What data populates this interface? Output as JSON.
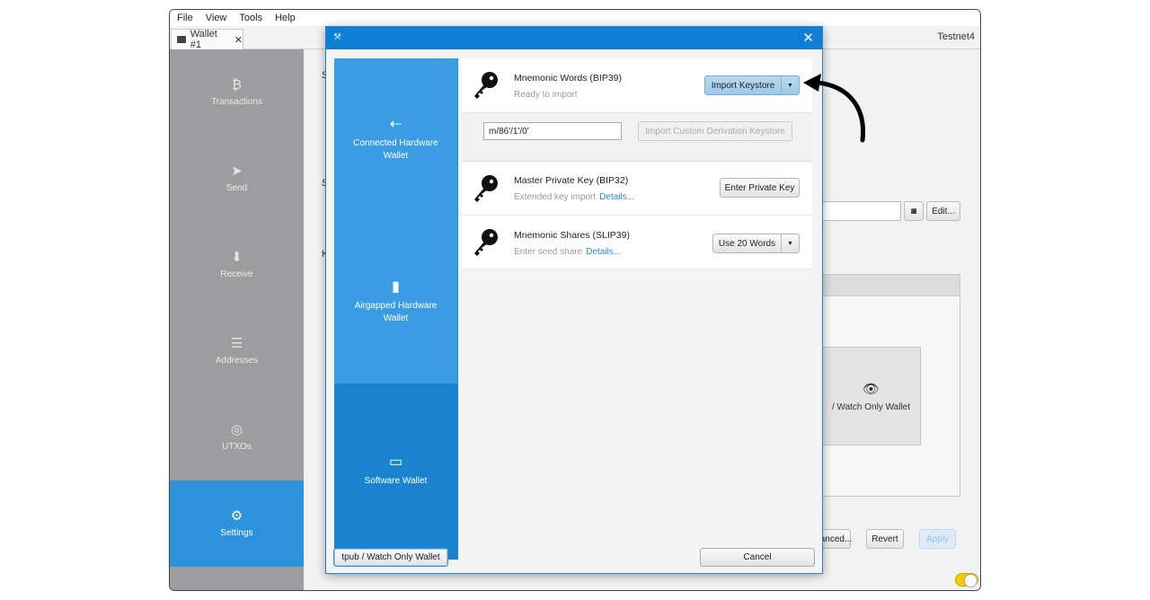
{
  "menu": [
    "File",
    "View",
    "Tools",
    "Help"
  ],
  "tab": {
    "label": "Wallet #1",
    "close": "✕"
  },
  "network": "Testnet4",
  "sidebar": {
    "items": [
      {
        "label": "Transactions",
        "icon": "bitcoin-icon",
        "glyph": "₿"
      },
      {
        "label": "Send",
        "icon": "send-icon",
        "glyph": "➤"
      },
      {
        "label": "Receive",
        "icon": "receive-icon",
        "glyph": "⬇"
      },
      {
        "label": "Addresses",
        "icon": "addresses-icon",
        "glyph": "☰"
      },
      {
        "label": "UTXOs",
        "icon": "coins-icon",
        "glyph": "◎"
      },
      {
        "label": "Settings",
        "icon": "gear-icon",
        "glyph": "⚙"
      }
    ]
  },
  "background": {
    "frag_s1": "S",
    "frag_s2": "S",
    "frag_k": "K",
    "edit_label": "Edit...",
    "watch_only_label": "/ Watch Only Wallet",
    "advanced_label": "anced...",
    "revert_label": "Revert",
    "apply_label": "Apply"
  },
  "dialog": {
    "close": "✕",
    "categories": [
      {
        "label": "Connected Hardware Wallet",
        "icon": "usb-icon",
        "glyph": "⭠"
      },
      {
        "label": "Airgapped Hardware Wallet",
        "icon": "sd-card-icon",
        "glyph": "▮"
      },
      {
        "label": "Software Wallet",
        "icon": "laptop-icon",
        "glyph": "💻"
      }
    ],
    "active_category": "Software Wallet",
    "keystores": [
      {
        "title": "Mnemonic Words (BIP39)",
        "subtitle": "Ready to import",
        "details": "",
        "button": "Import Keystore"
      },
      {
        "title": "Master Private Key (BIP32)",
        "subtitle": "Extended key import",
        "details": "Details...",
        "button": "Enter Private Key"
      },
      {
        "title": "Mnemonic Shares (SLIP39)",
        "subtitle": "Enter seed share",
        "details": "Details...",
        "button": "Use 20 Words"
      }
    ],
    "derivation": {
      "value": "m/86'/1'/0'",
      "button": "Import Custom Derivation Keystore"
    },
    "footer": {
      "left_button": "tpub / Watch Only Wallet",
      "cancel": "Cancel"
    }
  },
  "colors": {
    "accent": "#2d92dc",
    "title_bar": "#0f7fd6",
    "dialog_sidebar": "#3a9ce3"
  }
}
